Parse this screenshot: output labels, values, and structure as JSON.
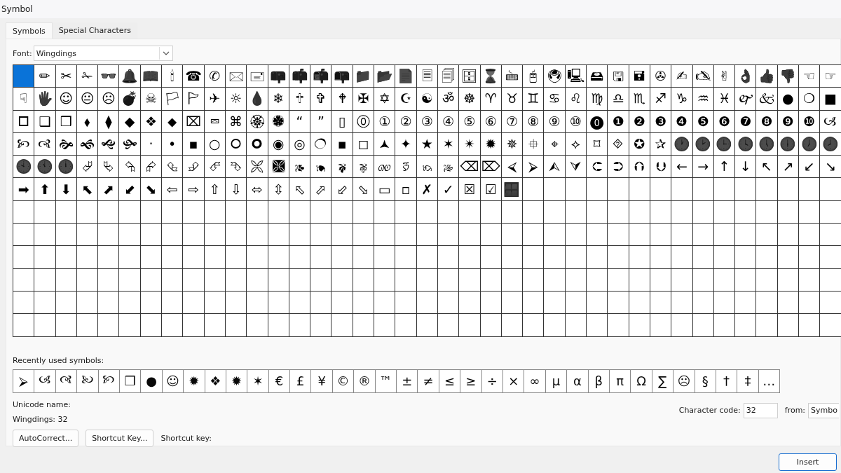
{
  "window": {
    "title": "Symbol"
  },
  "tabs": [
    {
      "label": "Symbols",
      "selected": true
    },
    {
      "label": "Special Characters",
      "selected": false
    }
  ],
  "font": {
    "label": "Font:",
    "value": "Wingdings"
  },
  "grid": {
    "rows": [
      [
        {
          "selected": true
        },
        {
          "glyph": "✏",
          "selected": false
        },
        {
          "glyph": "✂",
          "selected": false
        },
        {
          "glyph": "✁",
          "selected": false
        },
        {
          "glyph": "👓",
          "selected": false
        },
        {
          "glyph": "🔔",
          "selected": false
        },
        {
          "glyph": "📖",
          "selected": false
        },
        {
          "glyph": "🕯",
          "selected": false
        },
        {
          "glyph": "☎",
          "selected": false
        },
        {
          "glyph": "✆",
          "selected": false
        },
        {
          "glyph": "🖂",
          "selected": false
        },
        {
          "glyph": "🖃",
          "selected": false
        },
        {
          "glyph": "📪",
          "selected": false
        },
        {
          "glyph": "📫",
          "selected": false
        },
        {
          "glyph": "📬",
          "selected": false
        },
        {
          "glyph": "📭",
          "selected": false
        },
        {
          "glyph": "📁",
          "selected": false
        },
        {
          "glyph": "📂",
          "selected": false
        },
        {
          "glyph": "📄",
          "selected": false
        },
        {
          "glyph": "🗏",
          "selected": false
        },
        {
          "glyph": "🗐",
          "selected": false
        },
        {
          "glyph": "🗄",
          "selected": false
        },
        {
          "glyph": "⌛",
          "selected": false
        },
        {
          "glyph": "🖮",
          "selected": false
        },
        {
          "glyph": "🖰",
          "selected": false
        },
        {
          "glyph": "🖲",
          "selected": false
        },
        {
          "glyph": "🖳",
          "selected": false
        },
        {
          "glyph": "🖴",
          "selected": false
        },
        {
          "glyph": "🖫",
          "selected": false
        },
        {
          "glyph": "🖬",
          "selected": false
        },
        {
          "glyph": "✇",
          "selected": false
        },
        {
          "glyph": "✍",
          "selected": false
        },
        {
          "glyph": "🖎",
          "selected": false
        },
        {
          "glyph": "✌",
          "selected": false
        },
        {
          "glyph": "👌",
          "selected": false
        },
        {
          "glyph": "👍",
          "selected": false
        },
        {
          "glyph": "👎",
          "selected": false
        },
        {
          "glyph": "☜",
          "selected": false
        },
        {
          "glyph": "☞",
          "selected": false
        }
      ],
      [
        {
          "glyph": "☟",
          "selected": false
        },
        {
          "glyph": "🖐",
          "selected": false
        },
        {
          "glyph": "☺",
          "selected": false
        },
        {
          "glyph": "😐",
          "selected": false
        },
        {
          "glyph": "☹",
          "selected": false
        },
        {
          "glyph": "💣",
          "selected": false
        },
        {
          "glyph": "☠",
          "selected": false
        },
        {
          "glyph": "🏳",
          "selected": false
        },
        {
          "glyph": "🏱",
          "selected": false
        },
        {
          "glyph": "✈",
          "selected": false
        },
        {
          "glyph": "☼",
          "selected": false
        },
        {
          "glyph": "💧",
          "selected": false
        },
        {
          "glyph": "❄",
          "selected": false
        },
        {
          "glyph": "🕆",
          "selected": false
        },
        {
          "glyph": "✞",
          "selected": false
        },
        {
          "glyph": "🕈",
          "selected": false
        },
        {
          "glyph": "✠",
          "selected": false
        },
        {
          "glyph": "✡",
          "selected": false
        },
        {
          "glyph": "☪",
          "selected": false
        },
        {
          "glyph": "☯",
          "selected": false
        },
        {
          "glyph": "ॐ",
          "selected": false
        },
        {
          "glyph": "☸",
          "selected": false
        },
        {
          "glyph": "♈",
          "selected": false
        },
        {
          "glyph": "♉",
          "selected": false
        },
        {
          "glyph": "♊",
          "selected": false
        },
        {
          "glyph": "♋",
          "selected": false
        },
        {
          "glyph": "♌",
          "selected": false
        },
        {
          "glyph": "♍",
          "selected": false
        },
        {
          "glyph": "♎",
          "selected": false
        },
        {
          "glyph": "♏",
          "selected": false
        },
        {
          "glyph": "♐",
          "selected": false
        },
        {
          "glyph": "♑",
          "selected": false
        },
        {
          "glyph": "♒",
          "selected": false
        },
        {
          "glyph": "♓",
          "selected": false
        },
        {
          "glyph": "🙰",
          "selected": false
        },
        {
          "glyph": "🙵",
          "selected": false
        },
        {
          "glyph": "●",
          "selected": false
        },
        {
          "glyph": "❍",
          "selected": false
        },
        {
          "glyph": "■",
          "selected": false
        }
      ],
      [
        {
          "glyph": "🞐",
          "selected": false
        },
        {
          "glyph": "❑",
          "selected": false
        },
        {
          "glyph": "❒",
          "selected": false
        },
        {
          "glyph": "⬧",
          "selected": false
        },
        {
          "glyph": "⧫",
          "selected": false
        },
        {
          "glyph": "◆",
          "selected": false
        },
        {
          "glyph": "❖",
          "selected": false
        },
        {
          "glyph": "⬥",
          "selected": false
        },
        {
          "glyph": "⌧",
          "selected": false
        },
        {
          "glyph": "⮹",
          "selected": false
        },
        {
          "glyph": "⌘",
          "selected": false
        },
        {
          "glyph": "🏵",
          "selected": false
        },
        {
          "glyph": "🏶",
          "selected": false
        },
        {
          "glyph": "“",
          "selected": false
        },
        {
          "glyph": "”",
          "selected": false
        },
        {
          "glyph": "▯",
          "selected": false
        },
        {
          "glyph": "⓪",
          "selected": false
        },
        {
          "glyph": "①",
          "selected": false
        },
        {
          "glyph": "②",
          "selected": false
        },
        {
          "glyph": "③",
          "selected": false
        },
        {
          "glyph": "④",
          "selected": false
        },
        {
          "glyph": "⑤",
          "selected": false
        },
        {
          "glyph": "⑥",
          "selected": false
        },
        {
          "glyph": "⑦",
          "selected": false
        },
        {
          "glyph": "⑧",
          "selected": false
        },
        {
          "glyph": "⑨",
          "selected": false
        },
        {
          "glyph": "⑩",
          "selected": false
        },
        {
          "glyph": "⓿",
          "selected": false
        },
        {
          "glyph": "❶",
          "selected": false
        },
        {
          "glyph": "❷",
          "selected": false
        },
        {
          "glyph": "❸",
          "selected": false
        },
        {
          "glyph": "❹",
          "selected": false
        },
        {
          "glyph": "❺",
          "selected": false
        },
        {
          "glyph": "❻",
          "selected": false
        },
        {
          "glyph": "❼",
          "selected": false
        },
        {
          "glyph": "❽",
          "selected": false
        },
        {
          "glyph": "❾",
          "selected": false
        },
        {
          "glyph": "❿",
          "selected": false
        },
        {
          "glyph": "🙢",
          "selected": false
        }
      ],
      [
        {
          "glyph": "🙡",
          "selected": false
        },
        {
          "glyph": "🙣",
          "selected": false
        },
        {
          "glyph": "🙞",
          "selected": false
        },
        {
          "glyph": "🙜",
          "selected": false
        },
        {
          "glyph": "🙝",
          "selected": false
        },
        {
          "glyph": "🙟",
          "selected": false
        },
        {
          "glyph": "·",
          "selected": false
        },
        {
          "glyph": "•",
          "selected": false
        },
        {
          "glyph": "▪",
          "selected": false
        },
        {
          "glyph": "○",
          "selected": false
        },
        {
          "glyph": "🞆",
          "selected": false
        },
        {
          "glyph": "🞈",
          "selected": false
        },
        {
          "glyph": "◉",
          "selected": false
        },
        {
          "glyph": "◎",
          "selected": false
        },
        {
          "glyph": "🔿",
          "selected": false
        },
        {
          "glyph": "▪",
          "selected": false
        },
        {
          "glyph": "◻",
          "selected": false
        },
        {
          "glyph": "🟂",
          "selected": false
        },
        {
          "glyph": "✦",
          "selected": false
        },
        {
          "glyph": "★",
          "selected": false
        },
        {
          "glyph": "✶",
          "selected": false
        },
        {
          "glyph": "✴",
          "selected": false
        },
        {
          "glyph": "✹",
          "selected": false
        },
        {
          "glyph": "✵",
          "selected": false
        },
        {
          "glyph": "⯐",
          "selected": false
        },
        {
          "glyph": "⌖",
          "selected": false
        },
        {
          "glyph": "⟡",
          "selected": false
        },
        {
          "glyph": "⌑",
          "selected": false
        },
        {
          "glyph": "⯑",
          "selected": false
        },
        {
          "glyph": "✪",
          "selected": false
        },
        {
          "glyph": "✰",
          "selected": false
        },
        {
          "glyph": "🕐",
          "selected": false
        },
        {
          "glyph": "🕑",
          "selected": false
        },
        {
          "glyph": "🕒",
          "selected": false
        },
        {
          "glyph": "🕓",
          "selected": false
        },
        {
          "glyph": "🕔",
          "selected": false
        },
        {
          "glyph": "🕕",
          "selected": false
        },
        {
          "glyph": "🕖",
          "selected": false
        },
        {
          "glyph": "🕗",
          "selected": false
        }
      ],
      [
        {
          "glyph": "🕙",
          "selected": false
        },
        {
          "glyph": "🕚",
          "selected": false
        },
        {
          "glyph": "🕛",
          "selected": false
        },
        {
          "glyph": "⮰",
          "selected": false
        },
        {
          "glyph": "⮱",
          "selected": false
        },
        {
          "glyph": "⮲",
          "selected": false
        },
        {
          "glyph": "⮳",
          "selected": false
        },
        {
          "glyph": "⮴",
          "selected": false
        },
        {
          "glyph": "⮵",
          "selected": false
        },
        {
          "glyph": "⮶",
          "selected": false
        },
        {
          "glyph": "⮷",
          "selected": false
        },
        {
          "glyph": "🙪",
          "selected": false
        },
        {
          "glyph": "🙫",
          "selected": false
        },
        {
          "glyph": "🙕",
          "selected": false
        },
        {
          "glyph": "🙔",
          "selected": false
        },
        {
          "glyph": "🙗",
          "selected": false
        },
        {
          "glyph": "🙖",
          "selected": false
        },
        {
          "glyph": "🙐",
          "selected": false
        },
        {
          "glyph": "🙑",
          "selected": false
        },
        {
          "glyph": "🙒",
          "selected": false
        },
        {
          "glyph": "🙓",
          "selected": false
        },
        {
          "glyph": "⌫",
          "selected": false
        },
        {
          "glyph": "⌦",
          "selected": false
        },
        {
          "glyph": "⮘",
          "selected": false
        },
        {
          "glyph": "⮚",
          "selected": false
        },
        {
          "glyph": "⮙",
          "selected": false
        },
        {
          "glyph": "⮛",
          "selected": false
        },
        {
          "glyph": "⮈",
          "selected": false
        },
        {
          "glyph": "⮊",
          "selected": false
        },
        {
          "glyph": "⮉",
          "selected": false
        },
        {
          "glyph": "⮋",
          "selected": false
        },
        {
          "glyph": "←",
          "selected": false
        },
        {
          "glyph": "→",
          "selected": false
        },
        {
          "glyph": "↑",
          "selected": false
        },
        {
          "glyph": "↓",
          "selected": false
        },
        {
          "glyph": "↖",
          "selected": false
        },
        {
          "glyph": "↗",
          "selected": false
        },
        {
          "glyph": "↙",
          "selected": false
        },
        {
          "glyph": "↘",
          "selected": false
        }
      ],
      [
        {
          "glyph": "➡",
          "selected": false
        },
        {
          "glyph": "⬆",
          "selected": false
        },
        {
          "glyph": "⬇",
          "selected": false
        },
        {
          "glyph": "⬉",
          "selected": false
        },
        {
          "glyph": "⬈",
          "selected": false
        },
        {
          "glyph": "⬋",
          "selected": false
        },
        {
          "glyph": "⬊",
          "selected": false
        },
        {
          "glyph": "⇦",
          "selected": false
        },
        {
          "glyph": "⇨",
          "selected": false
        },
        {
          "glyph": "⇧",
          "selected": false
        },
        {
          "glyph": "⇩",
          "selected": false
        },
        {
          "glyph": "⬄",
          "selected": false
        },
        {
          "glyph": "⇳",
          "selected": false
        },
        {
          "glyph": "⬁",
          "selected": false
        },
        {
          "glyph": "⬀",
          "selected": false
        },
        {
          "glyph": "⬃",
          "selected": false
        },
        {
          "glyph": "⬂",
          "selected": false
        },
        {
          "glyph": "▭",
          "selected": false
        },
        {
          "glyph": "▫",
          "selected": false
        },
        {
          "glyph": "✗",
          "selected": false
        },
        {
          "glyph": "✓",
          "selected": false
        },
        {
          "glyph": "☒",
          "selected": false
        },
        {
          "glyph": "☑",
          "selected": false
        },
        {
          "glyph": "🪟",
          "selected": false
        }
      ]
    ]
  },
  "recent": {
    "label": "Recently used symbols:",
    "symbols": [
      "⮚",
      "🙢",
      "🙣",
      "🙠",
      "🙡",
      "❒",
      "●",
      "☺",
      "✹",
      "❖",
      "✹",
      "✶",
      "€",
      "£",
      "¥",
      "©",
      "®",
      "™",
      "±",
      "≠",
      "≤",
      "≥",
      "÷",
      "×",
      "∞",
      "µ",
      "α",
      "β",
      "π",
      "Ω",
      "∑",
      "☹",
      "§",
      "†",
      "‡",
      "…"
    ]
  },
  "unicode_name": {
    "label": "Unicode name:"
  },
  "char_info": "Wingdings: 32",
  "character_code": {
    "label": "Character code:",
    "value": "32"
  },
  "from": {
    "label": "from:",
    "value": "Symbo"
  },
  "buttons": [
    "AutoCorrect...",
    "Shortcut Key..."
  ],
  "shortcut_key": {
    "label": "Shortcut key:"
  },
  "footer_buttons": [
    "Insert"
  ]
}
